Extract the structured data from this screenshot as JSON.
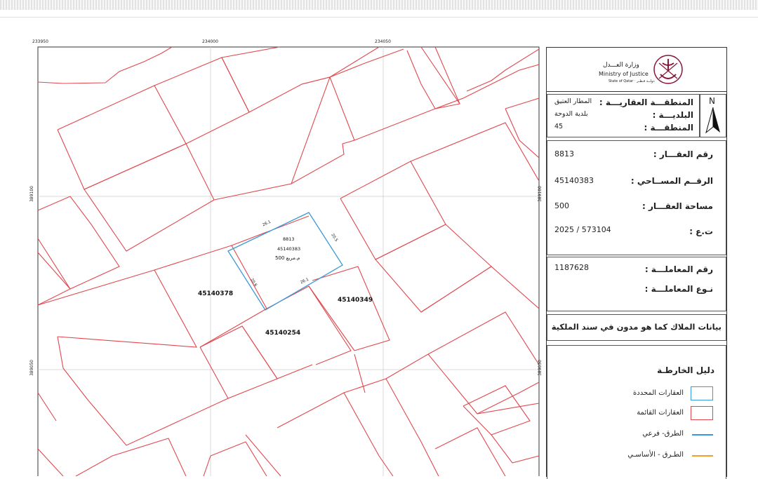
{
  "grid_coords": {
    "top": [
      "233950",
      "234000",
      "234050"
    ],
    "left": [
      "389100",
      "389050"
    ],
    "right": [
      "389100",
      "389050"
    ]
  },
  "map_labels": {
    "subject": {
      "number": "8813",
      "survey": "45140383",
      "area": "م.مربع 500"
    },
    "dims": [
      "26.1",
      "20.5",
      "26.1",
      "20.6"
    ],
    "neighbors": [
      "45140378",
      "45140349",
      "45140254"
    ]
  },
  "header": {
    "ministry_ar": "وزارة العـــدل",
    "ministry_en": "Ministry of Justice",
    "state": "State of Qatar ‧ دولــة قـطـر"
  },
  "north": "N",
  "location": {
    "zone_label": "المنطقـــة العقاريـــة :",
    "zone_value": "المطار العتيق",
    "municipality_label": "البلديـــة :",
    "municipality_value": "بلدية الدوحة",
    "area_label": "المنطقـــة :",
    "area_value": "45"
  },
  "property": {
    "number_label": "رقم العقـــار :",
    "number_value": "8813",
    "survey_label": "الرقــم المســاحي :",
    "survey_value": "45140383",
    "area_label": "مساحة العقـــار :",
    "area_value": "500",
    "te_label": "ت.ع :",
    "te_value": "2025 / 573104"
  },
  "transaction": {
    "number_label": "رقم المعاملـــة :",
    "number_value": "1187628",
    "type_label": "نـوع المعاملـــة :"
  },
  "owners_banner": "بيانات الملاك كما هو مدون في سند الملكية",
  "legend": {
    "title": "دليل الخارطـة",
    "items": [
      {
        "label": "العقارات المحددة",
        "kind": "box",
        "color": "#3a9ad9"
      },
      {
        "label": "العقارات القائمة",
        "kind": "box",
        "color": "#e0484e"
      },
      {
        "label": "الطرق- فرعي",
        "kind": "line",
        "color": "#3a9ad9"
      },
      {
        "label": "الطـرق - الأساسـي",
        "kind": "line",
        "color": "#f0a030"
      }
    ]
  },
  "colors": {
    "parcel": "#e0484e",
    "subject": "#3a9ad9",
    "grid": "#c8c8c8",
    "frame": "#333333"
  }
}
